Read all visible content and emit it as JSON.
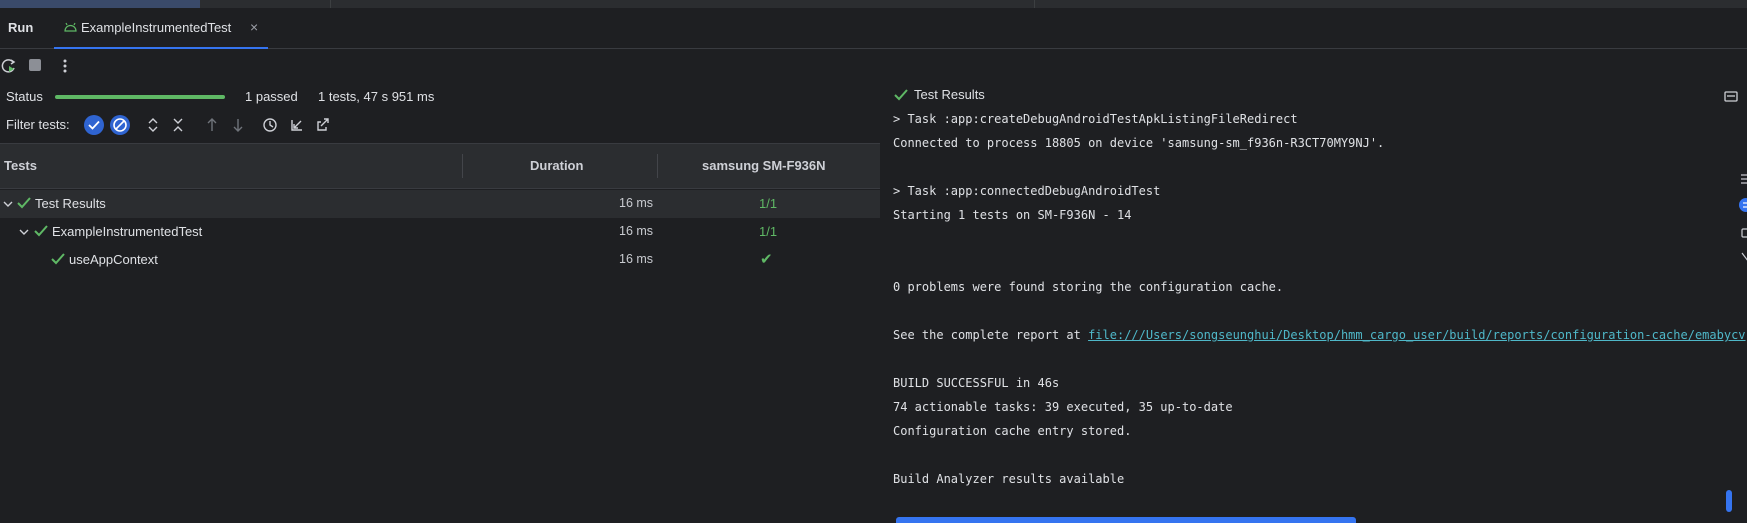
{
  "window": {
    "run_label": "Run",
    "tab_title": "ExampleInstrumentedTest",
    "tab_close": "×"
  },
  "toolbar": {
    "icons": [
      "rerun-icon",
      "stop-icon",
      "more-options-icon"
    ]
  },
  "status": {
    "label": "Status",
    "progress_fraction": 1.0,
    "progress_color": "#5fb865",
    "passed": "1 passed",
    "summary": "1 tests, 47 s 951 ms"
  },
  "filter": {
    "label": "Filter tests:"
  },
  "table": {
    "headers": {
      "tests": "Tests",
      "duration": "Duration",
      "device": "samsung SM-F936N"
    },
    "rows": [
      {
        "name": "Test Results",
        "duration": "16 ms",
        "result": "1/1"
      },
      {
        "name": "ExampleInstrumentedTest",
        "duration": "16 ms",
        "result": "1/1"
      },
      {
        "name": "useAppContext",
        "duration": "16 ms",
        "result": "✔"
      }
    ]
  },
  "console": {
    "header": "Test Results",
    "lines": {
      "l1": "> Task :app:createDebugAndroidTestApkListingFileRedirect",
      "l2": "Connected to process 18805 on device 'samsung-sm_f936n-R3CT70MY9NJ'.",
      "l3": "> Task :app:connectedDebugAndroidTest",
      "l4": "Starting 1 tests on SM-F936N - 14",
      "l5": "0 problems were found storing the configuration cache.",
      "l6_prefix": "See the complete report at ",
      "l6_link": "file:///Users/songseunghui/Desktop/hmm_cargo_user/build/reports/configuration-cache/emabycv",
      "l7": "BUILD SUCCESSFUL in 46s",
      "l8": "74 actionable tasks: 39 executed, 35 up-to-date",
      "l9": "Configuration cache entry stored.",
      "l10": "Build Analyzer results available"
    }
  },
  "colors": {
    "background": "#1e1f22",
    "panel": "#2b2d30",
    "accent": "#3574f0",
    "success": "#5fb865",
    "link": "#4fb8c9"
  }
}
